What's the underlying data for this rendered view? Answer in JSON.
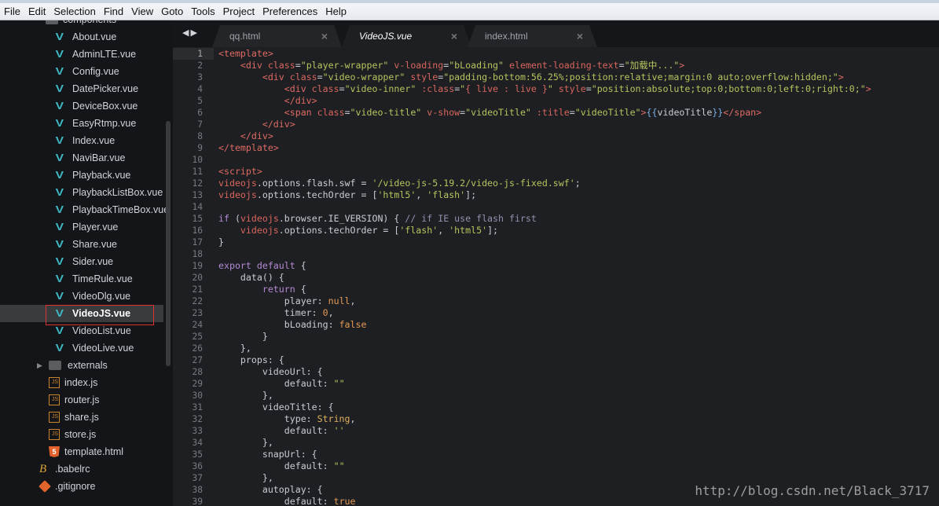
{
  "menu": [
    "File",
    "Edit",
    "Selection",
    "Find",
    "View",
    "Goto",
    "Tools",
    "Project",
    "Preferences",
    "Help"
  ],
  "sidebar": {
    "partial_folder": "components",
    "items": [
      {
        "label": "About.vue",
        "icon": "vue-icon",
        "indent": 1
      },
      {
        "label": "AdminLTE.vue",
        "icon": "vue-icon",
        "indent": 1
      },
      {
        "label": "Config.vue",
        "icon": "vue-icon",
        "indent": 1
      },
      {
        "label": "DatePicker.vue",
        "icon": "vue-icon",
        "indent": 1
      },
      {
        "label": "DeviceBox.vue",
        "icon": "vue-icon",
        "indent": 1
      },
      {
        "label": "EasyRtmp.vue",
        "icon": "vue-icon",
        "indent": 1
      },
      {
        "label": "Index.vue",
        "icon": "vue-icon",
        "indent": 1
      },
      {
        "label": "NaviBar.vue",
        "icon": "vue-icon",
        "indent": 1
      },
      {
        "label": "Playback.vue",
        "icon": "vue-icon",
        "indent": 1
      },
      {
        "label": "PlaybackListBox.vue",
        "icon": "vue-icon",
        "indent": 1
      },
      {
        "label": "PlaybackTimeBox.vue",
        "icon": "vue-icon",
        "indent": 1
      },
      {
        "label": "Player.vue",
        "icon": "vue-icon",
        "indent": 1
      },
      {
        "label": "Share.vue",
        "icon": "vue-icon",
        "indent": 1
      },
      {
        "label": "Sider.vue",
        "icon": "vue-icon",
        "indent": 1
      },
      {
        "label": "TimeRule.vue",
        "icon": "vue-icon",
        "indent": 1
      },
      {
        "label": "VideoDlg.vue",
        "icon": "vue-icon",
        "indent": 1
      },
      {
        "label": "VideoJS.vue",
        "icon": "vue-icon",
        "indent": 1,
        "selected": true
      },
      {
        "label": "VideoList.vue",
        "icon": "vue-icon",
        "indent": 1
      },
      {
        "label": "VideoLive.vue",
        "icon": "vue-icon",
        "indent": 1
      },
      {
        "label": "externals",
        "icon": "folder-icon",
        "indent": 0,
        "collapsed": true
      },
      {
        "label": "index.js",
        "icon": "js-icon",
        "indent": 0
      },
      {
        "label": "router.js",
        "icon": "js-icon",
        "indent": 0
      },
      {
        "label": "share.js",
        "icon": "js-icon",
        "indent": 0
      },
      {
        "label": "store.js",
        "icon": "js-icon",
        "indent": 0
      },
      {
        "label": "template.html",
        "icon": "html5-icon",
        "indent": 0
      },
      {
        "label": ".babelrc",
        "icon": "babel-icon",
        "indent": -1
      },
      {
        "label": ".gitignore",
        "icon": "git-icon",
        "indent": -1
      }
    ]
  },
  "tabs": [
    {
      "label": "qq.html",
      "active": false
    },
    {
      "label": "VideoJS.vue",
      "active": true
    },
    {
      "label": "index.html",
      "active": false
    }
  ],
  "editor": {
    "current_line": 1,
    "lines": [
      [
        [
          "t",
          "<template>"
        ]
      ],
      [
        [
          "",
          "    "
        ],
        [
          "t",
          "<div "
        ],
        [
          "a",
          "class"
        ],
        [
          "p",
          "="
        ],
        [
          "s",
          "\"player-wrapper\""
        ],
        [
          "",
          ""
        ],
        [
          "a",
          " v-loading"
        ],
        [
          "p",
          "="
        ],
        [
          "s",
          "\"bLoading\""
        ],
        [
          "a",
          " element-loading-text"
        ],
        [
          "p",
          "="
        ],
        [
          "s",
          "\"加载中...\""
        ],
        [
          "t",
          ">"
        ]
      ],
      [
        [
          "",
          "        "
        ],
        [
          "t",
          "<div "
        ],
        [
          "a",
          "class"
        ],
        [
          "p",
          "="
        ],
        [
          "s",
          "\"video-wrapper\""
        ],
        [
          "a",
          " style"
        ],
        [
          "p",
          "="
        ],
        [
          "s",
          "\"padding-bottom:56.25%;position:relative;margin:0 auto;overflow:hidden;\""
        ],
        [
          "t",
          ">"
        ]
      ],
      [
        [
          "",
          "            "
        ],
        [
          "t",
          "<div "
        ],
        [
          "a",
          "class"
        ],
        [
          "p",
          "="
        ],
        [
          "s",
          "\"video-inner\""
        ],
        [
          "a",
          " :class"
        ],
        [
          "p",
          "="
        ],
        [
          "s",
          "\""
        ],
        [
          "a",
          "{ live : live }"
        ],
        [
          "s",
          "\""
        ],
        [
          "a",
          " style"
        ],
        [
          "p",
          "="
        ],
        [
          "s",
          "\"position:absolute;top:0;bottom:0;left:0;right:0;\""
        ],
        [
          "t",
          ">"
        ]
      ],
      [
        [
          "",
          "            "
        ],
        [
          "t",
          "</div>"
        ]
      ],
      [
        [
          "",
          "            "
        ],
        [
          "t",
          "<span "
        ],
        [
          "a",
          "class"
        ],
        [
          "p",
          "="
        ],
        [
          "s",
          "\"video-title\""
        ],
        [
          "a",
          " v-show"
        ],
        [
          "p",
          "="
        ],
        [
          "s",
          "\"videoTitle\""
        ],
        [
          "a",
          " :title"
        ],
        [
          "p",
          "="
        ],
        [
          "s",
          "\"videoTitle\""
        ],
        [
          "t",
          ">"
        ],
        [
          "b",
          "{{"
        ],
        [
          "",
          "videoTitle"
        ],
        [
          "b",
          "}}"
        ],
        [
          "t",
          "</span>"
        ]
      ],
      [
        [
          "",
          "        "
        ],
        [
          "t",
          "</div>"
        ]
      ],
      [
        [
          "",
          "    "
        ],
        [
          "t",
          "</div>"
        ]
      ],
      [
        [
          "t",
          "</template>"
        ]
      ],
      [],
      [
        [
          "t",
          "<script>"
        ]
      ],
      [
        [
          "v",
          "videojs"
        ],
        [
          "p",
          ".options.flash.swf = "
        ],
        [
          "s",
          "'/video-js-5.19.2/video-js-fixed.swf'"
        ],
        [
          "p",
          ";"
        ]
      ],
      [
        [
          "v",
          "videojs"
        ],
        [
          "p",
          ".options.techOrder = ["
        ],
        [
          "s",
          "'html5'"
        ],
        [
          "p",
          ", "
        ],
        [
          "s",
          "'flash'"
        ],
        [
          "p",
          "];"
        ]
      ],
      [],
      [
        [
          "k",
          "if"
        ],
        [
          "p",
          " ("
        ],
        [
          "v",
          "videojs"
        ],
        [
          "p",
          ".browser.IE_VERSION) { "
        ],
        [
          "c",
          "// if IE use flash first"
        ]
      ],
      [
        [
          "",
          "    "
        ],
        [
          "v",
          "videojs"
        ],
        [
          "p",
          ".options.techOrder = ["
        ],
        [
          "s",
          "'flash'"
        ],
        [
          "p",
          ", "
        ],
        [
          "s",
          "'html5'"
        ],
        [
          "p",
          "];"
        ]
      ],
      [
        [
          "p",
          "}"
        ]
      ],
      [],
      [
        [
          "k",
          "export default"
        ],
        [
          "p",
          " {"
        ]
      ],
      [
        [
          "",
          "    data() {"
        ]
      ],
      [
        [
          "",
          "        "
        ],
        [
          "k",
          "return"
        ],
        [
          "p",
          " {"
        ]
      ],
      [
        [
          "",
          "            player: "
        ],
        [
          "n",
          "null"
        ],
        [
          "p",
          ","
        ]
      ],
      [
        [
          "",
          "            timer: "
        ],
        [
          "n",
          "0"
        ],
        [
          "p",
          ","
        ]
      ],
      [
        [
          "",
          "            bLoading: "
        ],
        [
          "n",
          "false"
        ]
      ],
      [
        [
          "",
          "        }"
        ]
      ],
      [
        [
          "",
          "    },"
        ]
      ],
      [
        [
          "",
          "    props: {"
        ]
      ],
      [
        [
          "",
          "        videoUrl: {"
        ]
      ],
      [
        [
          "",
          "            default: "
        ],
        [
          "s",
          "\"\""
        ]
      ],
      [
        [
          "",
          "        },"
        ]
      ],
      [
        [
          "",
          "        videoTitle: {"
        ]
      ],
      [
        [
          "",
          "            type: "
        ],
        [
          "y",
          "String"
        ],
        [
          "p",
          ","
        ]
      ],
      [
        [
          "",
          "            default: "
        ],
        [
          "s",
          "''"
        ]
      ],
      [
        [
          "",
          "        },"
        ]
      ],
      [
        [
          "",
          "        snapUrl: {"
        ]
      ],
      [
        [
          "",
          "            default: "
        ],
        [
          "s",
          "\"\""
        ]
      ],
      [
        [
          "",
          "        },"
        ]
      ],
      [
        [
          "",
          "        autoplay: {"
        ]
      ],
      [
        [
          "",
          "            default: "
        ],
        [
          "n",
          "true"
        ]
      ]
    ]
  },
  "watermark": "http://blog.csdn.net/Black_3717",
  "colors": {
    "tag": "#df6b64",
    "string": "#b5c45e",
    "keyword": "#b48ad4",
    "constant": "#e49a55",
    "background": "#1e1f22",
    "selection_box": "#e03030"
  }
}
